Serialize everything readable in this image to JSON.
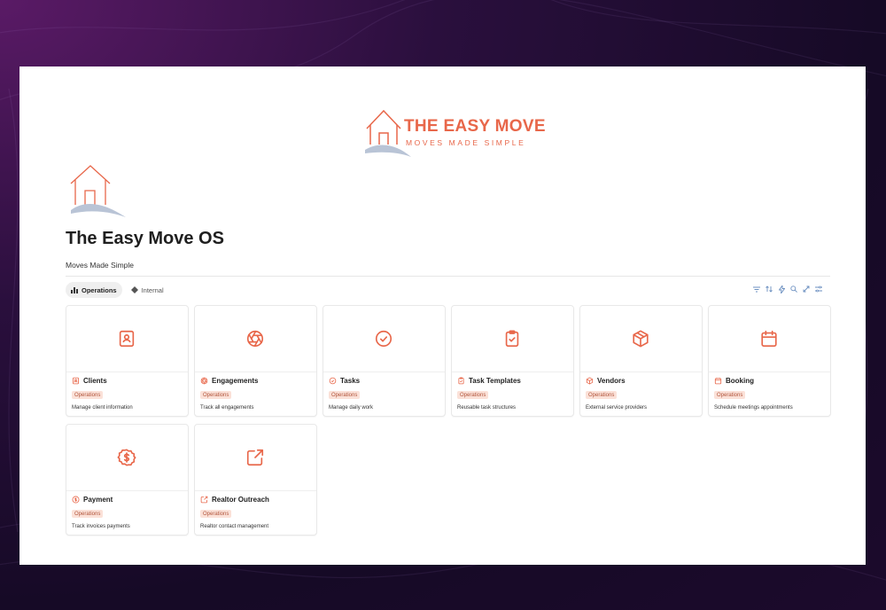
{
  "brand": {
    "name": "THE EASY MOVE",
    "tagline": "MOVES MADE SIMPLE",
    "accent_color": "#e8674a",
    "swoosh_color": "#b9c4d6"
  },
  "page": {
    "title": "The Easy Move OS",
    "subtitle": "Moves Made Simple",
    "icon": "house-logo-icon"
  },
  "tabs": [
    {
      "label": "Operations",
      "icon": "bar-chart-icon",
      "active": true
    },
    {
      "label": "Internal",
      "icon": "diamond-icon",
      "active": false
    }
  ],
  "toolbar": [
    "filter-icon",
    "sort-icon",
    "lightning-icon",
    "search-icon",
    "expand-icon",
    "settings-icon"
  ],
  "cards": [
    {
      "title": "Clients",
      "tag": "Operations",
      "description": "Manage client information",
      "icon": "contact-book-icon"
    },
    {
      "title": "Engagements",
      "tag": "Operations",
      "description": "Track all engagements",
      "icon": "aperture-icon"
    },
    {
      "title": "Tasks",
      "tag": "Operations",
      "description": "Manage daily work",
      "icon": "check-circle-icon"
    },
    {
      "title": "Task Templates",
      "tag": "Operations",
      "description": "Reusable task structures",
      "icon": "clipboard-check-icon"
    },
    {
      "title": "Vendors",
      "tag": "Operations",
      "description": "External service providers",
      "icon": "package-icon"
    },
    {
      "title": "Booking",
      "tag": "Operations",
      "description": "Schedule meetings appointments",
      "icon": "calendar-icon"
    },
    {
      "title": "Payment",
      "tag": "Operations",
      "description": "Track invoices payments",
      "icon": "dollar-badge-icon"
    },
    {
      "title": "Realtor Outreach",
      "tag": "Operations",
      "description": "Realtor contact management",
      "icon": "external-link-icon"
    }
  ]
}
